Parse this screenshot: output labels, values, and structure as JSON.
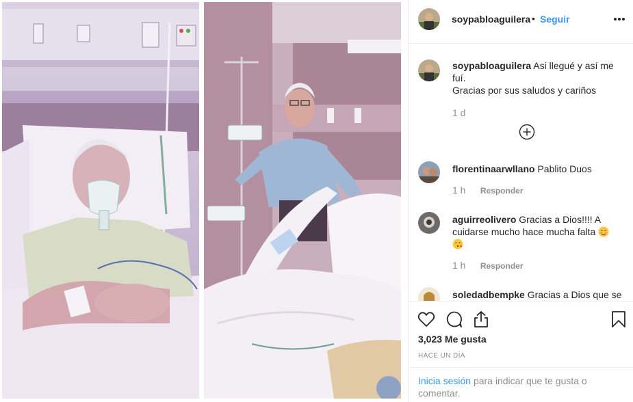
{
  "post": {
    "username": "soypabloaguilera",
    "dot": "•",
    "follow_label": "Seguir",
    "more_icon": "more-options-icon"
  },
  "caption": {
    "username": "soypabloaguilera",
    "line1": "Asi llegué y así me fuí.",
    "line2": "Gracias por sus saludos y cariños",
    "time": "1 d",
    "load_more_icon": "plus-circle-icon"
  },
  "comments": [
    {
      "username": "florentinaarwllano",
      "text": "Pablito Duos",
      "time": "1 h",
      "reply": "Responder"
    },
    {
      "username": "aguirreolivero",
      "text": "Gracias a Dios!!!! A cuidarse mucho hace mucha falta",
      "emojis": [
        "smiling-blush-emoji",
        "kissing-heart-emoji"
      ],
      "time": "1 h",
      "reply": "Responder"
    },
    {
      "username": "soledadbempke",
      "text": "Gracias a Dios que se"
    }
  ],
  "actions": {
    "like_icon": "heart-icon",
    "comment_icon": "comment-icon",
    "share_icon": "share-icon",
    "save_icon": "bookmark-icon"
  },
  "likes": "3,023 Me gusta",
  "date": "HACE UN DÍA",
  "login": {
    "link": "Inicia sesión",
    "rest": "para indicar que te gusta o comentar."
  },
  "colors": {
    "link_blue": "#3897f0",
    "text": "#262626",
    "muted": "#8e8e8e",
    "border": "#efefef",
    "photo_tint": "#c9a9d6"
  }
}
